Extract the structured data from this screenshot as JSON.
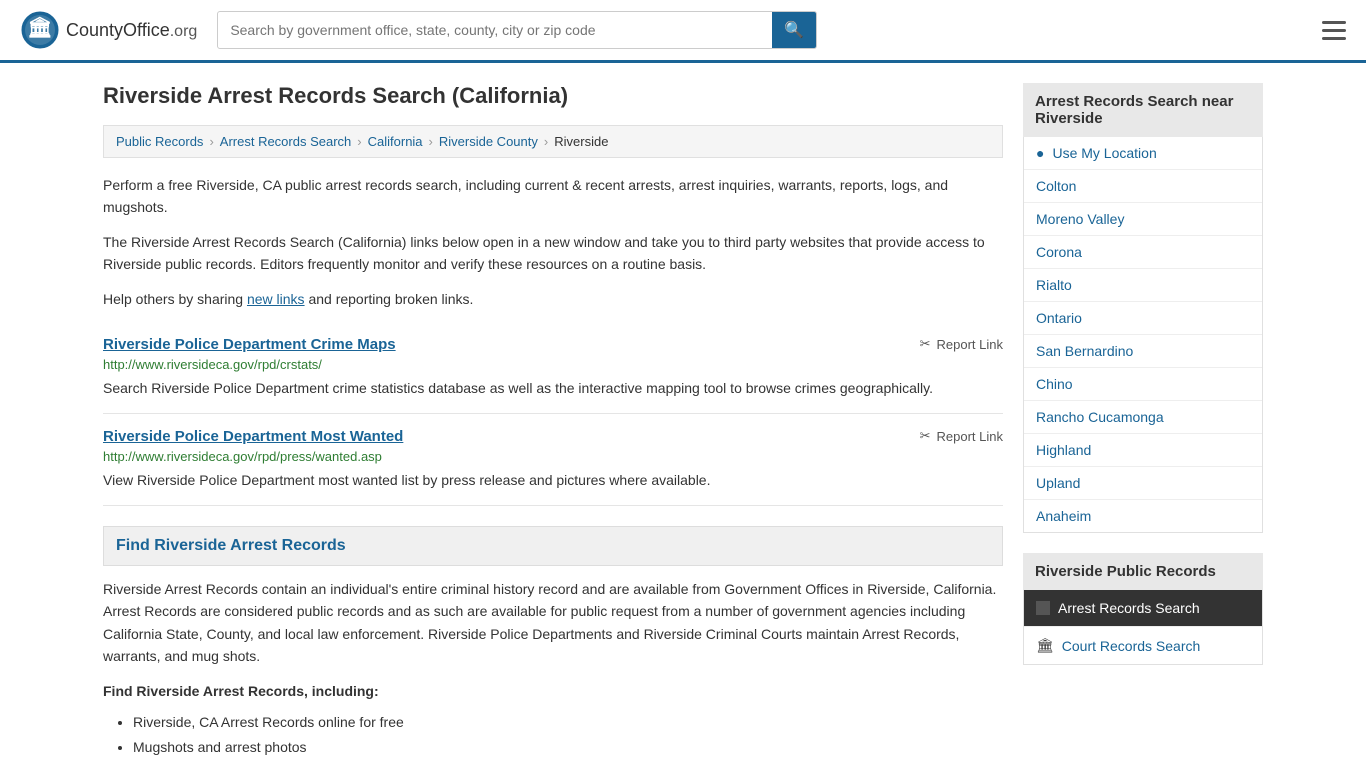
{
  "header": {
    "logo_text": "CountyOffice",
    "logo_suffix": ".org",
    "search_placeholder": "Search by government office, state, county, city or zip code"
  },
  "page": {
    "title": "Riverside Arrest Records Search (California)",
    "description1": "Perform a free Riverside, CA public arrest records search, including current & recent arrests, arrest inquiries, warrants, reports, logs, and mugshots.",
    "description2": "The Riverside Arrest Records Search (California) links below open in a new window and take you to third party websites that provide access to Riverside public records. Editors frequently monitor and verify these resources on a routine basis.",
    "description3": "Help others by sharing",
    "new_links": "new links",
    "description3_end": "and reporting broken links."
  },
  "breadcrumb": {
    "items": [
      {
        "label": "Public Records",
        "href": "#"
      },
      {
        "label": "Arrest Records Search",
        "href": "#"
      },
      {
        "label": "California",
        "href": "#"
      },
      {
        "label": "Riverside County",
        "href": "#"
      },
      {
        "label": "Riverside",
        "href": "#"
      }
    ]
  },
  "records": [
    {
      "title": "Riverside Police Department Crime Maps",
      "url": "http://www.riversideca.gov/rpd/crstats/",
      "description": "Search Riverside Police Department crime statistics database as well as the interactive mapping tool to browse crimes geographically.",
      "report_label": "Report Link"
    },
    {
      "title": "Riverside Police Department Most Wanted",
      "url": "http://www.riversideca.gov/rpd/press/wanted.asp",
      "description": "View Riverside Police Department most wanted list by press release and pictures where available.",
      "report_label": "Report Link"
    }
  ],
  "find_section": {
    "heading": "Find Riverside Arrest Records",
    "body": "Riverside Arrest Records contain an individual's entire criminal history record and are available from Government Offices in Riverside, California. Arrest Records are considered public records and as such are available for public request from a number of government agencies including California State, County, and local law enforcement. Riverside Police Departments and Riverside Criminal Courts maintain Arrest Records, warrants, and mug shots.",
    "subheading": "Find Riverside Arrest Records, including:",
    "bullets": [
      "Riverside, CA Arrest Records online for free",
      "Mugshots and arrest photos"
    ]
  },
  "sidebar": {
    "nearby_title": "Arrest Records Search near Riverside",
    "use_my_location": "Use My Location",
    "nearby_cities": [
      "Colton",
      "Moreno Valley",
      "Corona",
      "Rialto",
      "Ontario",
      "San Bernardino",
      "Chino",
      "Rancho Cucamonga",
      "Highland",
      "Upland",
      "Anaheim"
    ],
    "pub_records_title": "Riverside Public Records",
    "pub_records": [
      {
        "label": "Arrest Records Search",
        "active": true,
        "icon": "checkbox"
      },
      {
        "label": "Court Records Search",
        "active": false,
        "icon": "building"
      }
    ]
  }
}
